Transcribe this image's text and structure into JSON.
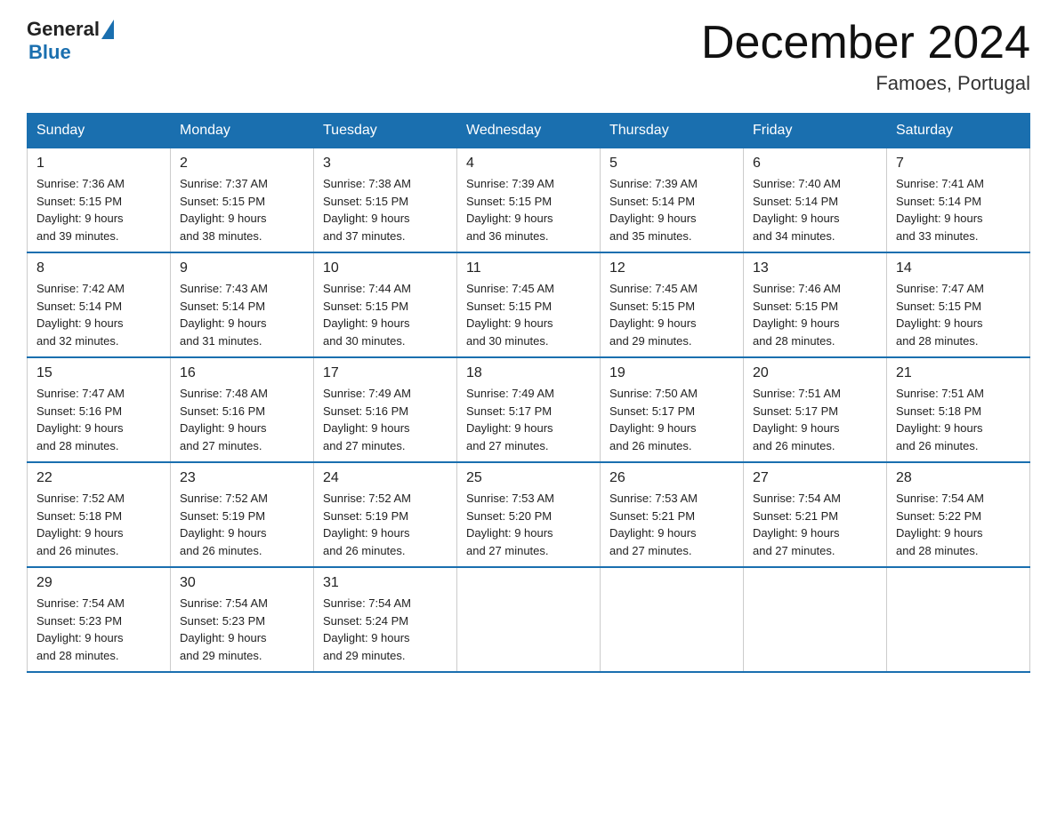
{
  "header": {
    "logo_general": "General",
    "logo_blue": "Blue",
    "title": "December 2024",
    "location": "Famoes, Portugal"
  },
  "weekdays": [
    "Sunday",
    "Monday",
    "Tuesday",
    "Wednesday",
    "Thursday",
    "Friday",
    "Saturday"
  ],
  "weeks": [
    [
      {
        "day": "1",
        "sunrise": "7:36 AM",
        "sunset": "5:15 PM",
        "daylight": "9 hours and 39 minutes."
      },
      {
        "day": "2",
        "sunrise": "7:37 AM",
        "sunset": "5:15 PM",
        "daylight": "9 hours and 38 minutes."
      },
      {
        "day": "3",
        "sunrise": "7:38 AM",
        "sunset": "5:15 PM",
        "daylight": "9 hours and 37 minutes."
      },
      {
        "day": "4",
        "sunrise": "7:39 AM",
        "sunset": "5:15 PM",
        "daylight": "9 hours and 36 minutes."
      },
      {
        "day": "5",
        "sunrise": "7:39 AM",
        "sunset": "5:14 PM",
        "daylight": "9 hours and 35 minutes."
      },
      {
        "day": "6",
        "sunrise": "7:40 AM",
        "sunset": "5:14 PM",
        "daylight": "9 hours and 34 minutes."
      },
      {
        "day": "7",
        "sunrise": "7:41 AM",
        "sunset": "5:14 PM",
        "daylight": "9 hours and 33 minutes."
      }
    ],
    [
      {
        "day": "8",
        "sunrise": "7:42 AM",
        "sunset": "5:14 PM",
        "daylight": "9 hours and 32 minutes."
      },
      {
        "day": "9",
        "sunrise": "7:43 AM",
        "sunset": "5:14 PM",
        "daylight": "9 hours and 31 minutes."
      },
      {
        "day": "10",
        "sunrise": "7:44 AM",
        "sunset": "5:15 PM",
        "daylight": "9 hours and 30 minutes."
      },
      {
        "day": "11",
        "sunrise": "7:45 AM",
        "sunset": "5:15 PM",
        "daylight": "9 hours and 30 minutes."
      },
      {
        "day": "12",
        "sunrise": "7:45 AM",
        "sunset": "5:15 PM",
        "daylight": "9 hours and 29 minutes."
      },
      {
        "day": "13",
        "sunrise": "7:46 AM",
        "sunset": "5:15 PM",
        "daylight": "9 hours and 28 minutes."
      },
      {
        "day": "14",
        "sunrise": "7:47 AM",
        "sunset": "5:15 PM",
        "daylight": "9 hours and 28 minutes."
      }
    ],
    [
      {
        "day": "15",
        "sunrise": "7:47 AM",
        "sunset": "5:16 PM",
        "daylight": "9 hours and 28 minutes."
      },
      {
        "day": "16",
        "sunrise": "7:48 AM",
        "sunset": "5:16 PM",
        "daylight": "9 hours and 27 minutes."
      },
      {
        "day": "17",
        "sunrise": "7:49 AM",
        "sunset": "5:16 PM",
        "daylight": "9 hours and 27 minutes."
      },
      {
        "day": "18",
        "sunrise": "7:49 AM",
        "sunset": "5:17 PM",
        "daylight": "9 hours and 27 minutes."
      },
      {
        "day": "19",
        "sunrise": "7:50 AM",
        "sunset": "5:17 PM",
        "daylight": "9 hours and 26 minutes."
      },
      {
        "day": "20",
        "sunrise": "7:51 AM",
        "sunset": "5:17 PM",
        "daylight": "9 hours and 26 minutes."
      },
      {
        "day": "21",
        "sunrise": "7:51 AM",
        "sunset": "5:18 PM",
        "daylight": "9 hours and 26 minutes."
      }
    ],
    [
      {
        "day": "22",
        "sunrise": "7:52 AM",
        "sunset": "5:18 PM",
        "daylight": "9 hours and 26 minutes."
      },
      {
        "day": "23",
        "sunrise": "7:52 AM",
        "sunset": "5:19 PM",
        "daylight": "9 hours and 26 minutes."
      },
      {
        "day": "24",
        "sunrise": "7:52 AM",
        "sunset": "5:19 PM",
        "daylight": "9 hours and 26 minutes."
      },
      {
        "day": "25",
        "sunrise": "7:53 AM",
        "sunset": "5:20 PM",
        "daylight": "9 hours and 27 minutes."
      },
      {
        "day": "26",
        "sunrise": "7:53 AM",
        "sunset": "5:21 PM",
        "daylight": "9 hours and 27 minutes."
      },
      {
        "day": "27",
        "sunrise": "7:54 AM",
        "sunset": "5:21 PM",
        "daylight": "9 hours and 27 minutes."
      },
      {
        "day": "28",
        "sunrise": "7:54 AM",
        "sunset": "5:22 PM",
        "daylight": "9 hours and 28 minutes."
      }
    ],
    [
      {
        "day": "29",
        "sunrise": "7:54 AM",
        "sunset": "5:23 PM",
        "daylight": "9 hours and 28 minutes."
      },
      {
        "day": "30",
        "sunrise": "7:54 AM",
        "sunset": "5:23 PM",
        "daylight": "9 hours and 29 minutes."
      },
      {
        "day": "31",
        "sunrise": "7:54 AM",
        "sunset": "5:24 PM",
        "daylight": "9 hours and 29 minutes."
      },
      null,
      null,
      null,
      null
    ]
  ],
  "labels": {
    "sunrise": "Sunrise:",
    "sunset": "Sunset:",
    "daylight": "Daylight:"
  }
}
